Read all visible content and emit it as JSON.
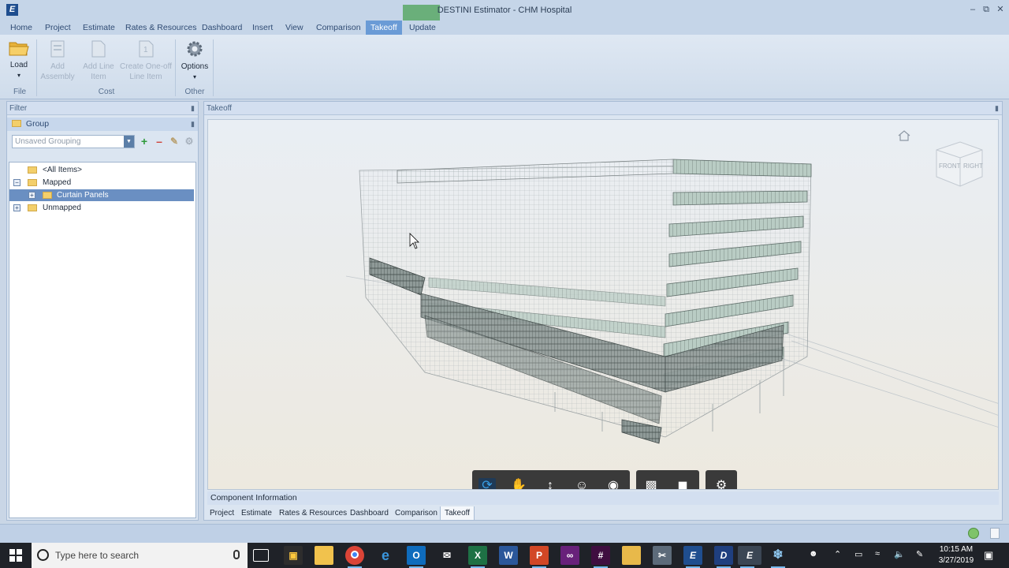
{
  "window": {
    "title": "DESTINI Estimator - CHM Hospital",
    "app_icon": "E"
  },
  "tabs": [
    {
      "label": "Home"
    },
    {
      "label": "Project"
    },
    {
      "label": "Estimate"
    },
    {
      "label": "Rates & Resources"
    },
    {
      "label": "Dashboard"
    },
    {
      "label": "Insert"
    },
    {
      "label": "View"
    },
    {
      "label": "Comparison"
    },
    {
      "label": "Takeoff",
      "active": true
    },
    {
      "label": "Update"
    }
  ],
  "ribbon": {
    "load": "Load",
    "add_assembly": "Add Assembly",
    "add_line_item": "Add Line Item",
    "create_one_off": "Create One-off Line Item",
    "options": "Options",
    "groups": {
      "file": "File",
      "cost": "Cost",
      "other": "Other"
    }
  },
  "filter_panel": {
    "title": "Filter",
    "group_label": "Group",
    "grouping_value": "Unsaved Grouping",
    "tree": {
      "all_items": "<All Items>",
      "mapped": "Mapped",
      "curtain_panels": "Curtain Panels",
      "unmapped": "Unmapped"
    }
  },
  "takeoff_panel": {
    "title": "Takeoff",
    "viewcube": {
      "front": "FRONT",
      "right": "RIGHT"
    },
    "component_info": "Component Information",
    "bottom_tabs": [
      {
        "label": "Project"
      },
      {
        "label": "Estimate"
      },
      {
        "label": "Rates & Resources"
      },
      {
        "label": "Dashboard"
      },
      {
        "label": "Comparison"
      },
      {
        "label": "Takeoff",
        "active": true
      }
    ]
  },
  "taskbar": {
    "search_placeholder": "Type here to search",
    "time": "10:15 AM",
    "date": "3/27/2019",
    "apps": [
      "task-view",
      "store",
      "file-explorer",
      "chrome",
      "edge",
      "outlook",
      "mail",
      "excel",
      "word",
      "powerpoint",
      "visual-studio",
      "slack",
      "folder",
      "snipping",
      "destini-e",
      "destini-d",
      "destini-active",
      "app-snowflake"
    ]
  },
  "colors": {
    "accent_tab": "#6a9bd6",
    "update_tab": "#59a866",
    "taskbar": "#1f2228"
  }
}
